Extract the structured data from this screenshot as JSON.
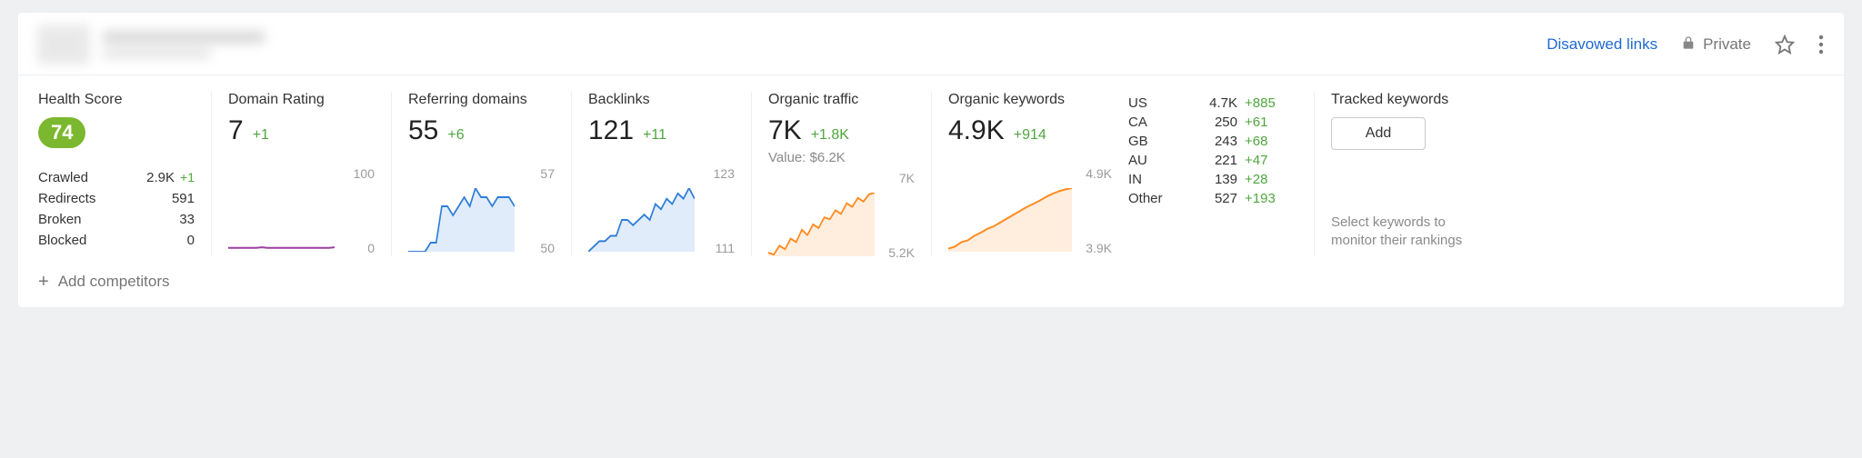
{
  "header": {
    "disavowed_label": "Disavowed links",
    "private_label": "Private"
  },
  "health": {
    "title": "Health Score",
    "score": "74",
    "rows": {
      "crawled": {
        "label": "Crawled",
        "value": "2.9K",
        "delta": "+1"
      },
      "redirects": {
        "label": "Redirects",
        "value": "591",
        "delta": ""
      },
      "broken": {
        "label": "Broken",
        "value": "33",
        "delta": ""
      },
      "blocked": {
        "label": "Blocked",
        "value": "0",
        "delta": ""
      }
    }
  },
  "metrics": {
    "domain_rating": {
      "title": "Domain Rating",
      "value": "7",
      "delta": "+1",
      "axis_top": "100",
      "axis_bottom": "0"
    },
    "referring_domains": {
      "title": "Referring domains",
      "value": "55",
      "delta": "+6",
      "axis_top": "57",
      "axis_bottom": "50"
    },
    "backlinks": {
      "title": "Backlinks",
      "value": "121",
      "delta": "+11",
      "axis_top": "123",
      "axis_bottom": "111"
    },
    "organic_traffic": {
      "title": "Organic traffic",
      "value": "7K",
      "delta": "+1.8K",
      "subnote": "Value: $6.2K",
      "axis_top": "7K",
      "axis_bottom": "5.2K"
    },
    "organic_keywords": {
      "title": "Organic keywords",
      "value": "4.9K",
      "delta": "+914",
      "axis_top": "4.9K",
      "axis_bottom": "3.9K"
    }
  },
  "countries": {
    "us": {
      "code": "US",
      "value": "4.7K",
      "delta": "+885"
    },
    "ca": {
      "code": "CA",
      "value": "250",
      "delta": "+61"
    },
    "gb": {
      "code": "GB",
      "value": "243",
      "delta": "+68"
    },
    "au": {
      "code": "AU",
      "value": "221",
      "delta": "+47"
    },
    "in": {
      "code": "IN",
      "value": "139",
      "delta": "+28"
    },
    "other": {
      "code": "Other",
      "value": "527",
      "delta": "+193"
    }
  },
  "tracked": {
    "title": "Tracked keywords",
    "add_label": "Add",
    "help_text": "Select keywords to monitor their rankings"
  },
  "footer": {
    "add_competitors": "Add competitors"
  },
  "chart_data": [
    {
      "type": "line",
      "title": "Domain Rating",
      "ylim": [
        0,
        100
      ],
      "x": [
        0,
        1,
        2,
        3,
        4,
        5,
        6,
        7,
        8,
        9,
        10,
        11,
        12,
        13,
        14,
        15,
        16,
        17,
        18,
        19
      ],
      "values": [
        6,
        6,
        6,
        6,
        6,
        6,
        7,
        6,
        6,
        6,
        6,
        6,
        6,
        6,
        6,
        6,
        6,
        6,
        6,
        7
      ],
      "color": "#9b3fa0"
    },
    {
      "type": "area",
      "title": "Referring domains",
      "ylim": [
        50,
        57
      ],
      "x": [
        0,
        1,
        2,
        3,
        4,
        5,
        6,
        7,
        8,
        9,
        10,
        11,
        12,
        13,
        14,
        15,
        16,
        17,
        18,
        19
      ],
      "values": [
        50,
        50,
        50,
        50,
        51,
        51,
        55,
        55,
        54,
        55,
        56,
        55,
        57,
        56,
        56,
        55,
        56,
        56,
        56,
        55
      ],
      "color": "#2f7ed8"
    },
    {
      "type": "area",
      "title": "Backlinks",
      "ylim": [
        111,
        123
      ],
      "x": [
        0,
        1,
        2,
        3,
        4,
        5,
        6,
        7,
        8,
        9,
        10,
        11,
        12,
        13,
        14,
        15,
        16,
        17,
        18,
        19
      ],
      "values": [
        111,
        112,
        113,
        113,
        114,
        114,
        117,
        117,
        116,
        117,
        118,
        117,
        120,
        119,
        121,
        120,
        122,
        121,
        123,
        121
      ],
      "color": "#2f7ed8"
    },
    {
      "type": "area",
      "title": "Organic traffic",
      "ylim": [
        5200,
        7000
      ],
      "x": [
        0,
        1,
        2,
        3,
        4,
        5,
        6,
        7,
        8,
        9,
        10,
        11,
        12,
        13,
        14,
        15,
        16,
        17,
        18,
        19
      ],
      "values": [
        5300,
        5250,
        5500,
        5400,
        5700,
        5600,
        5950,
        5800,
        6100,
        6000,
        6300,
        6250,
        6500,
        6400,
        6700,
        6600,
        6850,
        6750,
        6950,
        7000
      ],
      "color": "#ff8a1f"
    },
    {
      "type": "area",
      "title": "Organic keywords",
      "ylim": [
        3900,
        4900
      ],
      "x": [
        0,
        1,
        2,
        3,
        4,
        5,
        6,
        7,
        8,
        9,
        10,
        11,
        12,
        13,
        14,
        15,
        16,
        17,
        18,
        19
      ],
      "values": [
        3950,
        3980,
        4050,
        4080,
        4150,
        4200,
        4260,
        4300,
        4360,
        4420,
        4480,
        4540,
        4600,
        4650,
        4700,
        4760,
        4810,
        4850,
        4880,
        4900
      ],
      "color": "#ff8a1f"
    }
  ]
}
